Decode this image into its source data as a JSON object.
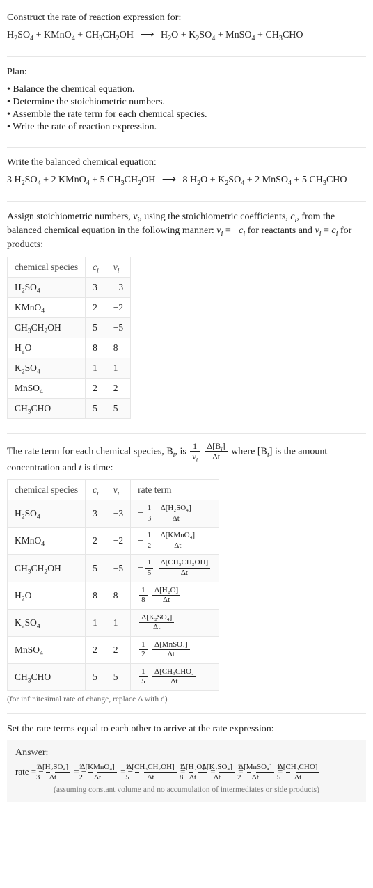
{
  "title": "Construct the rate of reaction expression for:",
  "unbalanced_lhs": [
    {
      "f": "H",
      "s": "2"
    },
    {
      "f": "SO",
      "s": "4"
    },
    {
      "plus": true
    },
    {
      "f": "KMnO",
      "s": "4"
    },
    {
      "plus": true
    },
    {
      "f": "CH",
      "s": "3"
    },
    {
      "f": "CH",
      "s": "2"
    },
    {
      "f": "OH"
    }
  ],
  "unbalanced_rhs": [
    {
      "f": "H",
      "s": "2"
    },
    {
      "f": "O"
    },
    {
      "plus": true
    },
    {
      "f": "K",
      "s": "2"
    },
    {
      "f": "SO",
      "s": "4"
    },
    {
      "plus": true
    },
    {
      "f": "MnSO",
      "s": "4"
    },
    {
      "plus": true
    },
    {
      "f": "CH",
      "s": "3"
    },
    {
      "f": "CHO"
    }
  ],
  "plan_label": "Plan:",
  "plan_items": [
    "Balance the chemical equation.",
    "Determine the stoichiometric numbers.",
    "Assemble the rate term for each chemical species.",
    "Write the rate of reaction expression."
  ],
  "balanced_label": "Write the balanced chemical equation:",
  "balanced_lhs": [
    {
      "coef": "3 "
    },
    {
      "f": "H",
      "s": "2"
    },
    {
      "f": "SO",
      "s": "4"
    },
    {
      "plus": true
    },
    {
      "coef": "2 "
    },
    {
      "f": "KMnO",
      "s": "4"
    },
    {
      "plus": true
    },
    {
      "coef": "5 "
    },
    {
      "f": "CH",
      "s": "3"
    },
    {
      "f": "CH",
      "s": "2"
    },
    {
      "f": "OH"
    }
  ],
  "balanced_rhs": [
    {
      "coef": "8 "
    },
    {
      "f": "H",
      "s": "2"
    },
    {
      "f": "O"
    },
    {
      "plus": true
    },
    {
      "f": "K",
      "s": "2"
    },
    {
      "f": "SO",
      "s": "4"
    },
    {
      "plus": true
    },
    {
      "coef": "2 "
    },
    {
      "f": "MnSO",
      "s": "4"
    },
    {
      "plus": true
    },
    {
      "coef": "5 "
    },
    {
      "f": "CH",
      "s": "3"
    },
    {
      "f": "CHO"
    }
  ],
  "assign_text_a": "Assign stoichiometric numbers, ",
  "assign_text_b": ", using the stoichiometric coefficients, ",
  "assign_text_c": ", from the balanced chemical equation in the following manner: ",
  "assign_text_d": " for reactants and ",
  "assign_text_e": " for products:",
  "nu_sym": "ν",
  "c_sym": "c",
  "i_sym": "i",
  "eq_react": " = −",
  "eq_prod": " = ",
  "table1_headers": [
    "chemical species"
  ],
  "species": [
    {
      "name_tokens": [
        {
          "f": "H",
          "s": "2"
        },
        {
          "f": "SO",
          "s": "4"
        }
      ],
      "c": "3",
      "nu": "−3",
      "rate_sign": "−",
      "rate_num": "1",
      "rate_den": "3",
      "delta": "Δ[H₂SO₄]"
    },
    {
      "name_tokens": [
        {
          "f": "KMnO",
          "s": "4"
        }
      ],
      "c": "2",
      "nu": "−2",
      "rate_sign": "−",
      "rate_num": "1",
      "rate_den": "2",
      "delta": "Δ[KMnO₄]"
    },
    {
      "name_tokens": [
        {
          "f": "CH",
          "s": "3"
        },
        {
          "f": "CH",
          "s": "2"
        },
        {
          "f": "OH"
        }
      ],
      "c": "5",
      "nu": "−5",
      "rate_sign": "−",
      "rate_num": "1",
      "rate_den": "5",
      "delta": "Δ[CH₃CH₂OH]"
    },
    {
      "name_tokens": [
        {
          "f": "H",
          "s": "2"
        },
        {
          "f": "O"
        }
      ],
      "c": "8",
      "nu": "8",
      "rate_sign": "",
      "rate_num": "1",
      "rate_den": "8",
      "delta": "Δ[H₂O]"
    },
    {
      "name_tokens": [
        {
          "f": "K",
          "s": "2"
        },
        {
          "f": "SO",
          "s": "4"
        }
      ],
      "c": "1",
      "nu": "1",
      "rate_sign": "",
      "rate_num": "",
      "rate_den": "",
      "delta": "Δ[K₂SO₄]"
    },
    {
      "name_tokens": [
        {
          "f": "MnSO",
          "s": "4"
        }
      ],
      "c": "2",
      "nu": "2",
      "rate_sign": "",
      "rate_num": "1",
      "rate_den": "2",
      "delta": "Δ[MnSO₄]"
    },
    {
      "name_tokens": [
        {
          "f": "CH",
          "s": "3"
        },
        {
          "f": "CHO"
        }
      ],
      "c": "5",
      "nu": "5",
      "rate_sign": "",
      "rate_num": "1",
      "rate_den": "5",
      "delta": "Δ[CH₃CHO]"
    }
  ],
  "rate_intro_a": "The rate term for each chemical species, B",
  "rate_intro_b": ", is ",
  "rate_intro_c": " where [B",
  "rate_intro_d": "] is the amount concentration and ",
  "rate_intro_e": " is time:",
  "t_sym": "t",
  "dt_sym": "Δt",
  "rate_header": "rate term",
  "table_note": "(for infinitesimal rate of change, replace Δ with d)",
  "final_label": "Set the rate terms equal to each other to arrive at the rate expression:",
  "answer_label": "Answer:",
  "rate_word": "rate",
  "answer_note": "(assuming constant volume and no accumulation of intermediates or side products)",
  "delta_bi": "Δ[B"
}
